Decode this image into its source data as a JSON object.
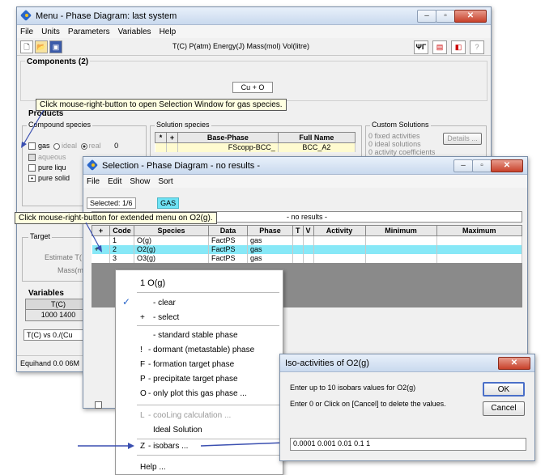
{
  "main_window": {
    "title": "Menu - Phase Diagram: last system",
    "menu": [
      "File",
      "Units",
      "Parameters",
      "Variables",
      "Help"
    ],
    "units_text": "T(C) P(atm) Energy(J) Mass(mol) Vol(litre)",
    "components_label": "Components",
    "components_count": "(2)",
    "components_value": "Cu + O",
    "products_label": "Products",
    "compound_species_label": "Compound species",
    "gas_label": "gas",
    "ideal_label": "ideal",
    "real_label": "real",
    "gas_count": "0",
    "aqueous_label": "aqueous",
    "pure_liquid_label": "pure liqu",
    "pure_solid_label": "pure solid",
    "solution_species_label": "Solution species",
    "solution_headers": [
      "*",
      "+",
      "Base-Phase",
      "Full Name"
    ],
    "solution_row": [
      "FScopp-BCC_",
      "BCC_A2"
    ],
    "custom_solutions_label": "Custom Solutions",
    "fixed_activities": "fixed activities",
    "ideal_solutions": "ideal solutions",
    "activity_coefficients": "activity coefficients",
    "details_button": "Details ...",
    "zero": "0",
    "target_label": "Target",
    "estimate_label": "Estimate T(",
    "mass_label": "Mass(m",
    "variables_label": "Variables",
    "var_header": "T(C)",
    "var_value": "1000 1400",
    "axis_label": "T(C) vs 0./(Cu",
    "status": "Equihand 0.0 06M"
  },
  "tooltip_main": "Click mouse-right-button to open Selection Window for gas species.",
  "selection_window": {
    "title": "Selection - Phase Diagram   - no results -",
    "menu": [
      "File",
      "Edit",
      "Show",
      "Sort"
    ],
    "selected_label": "Selected: 1/6",
    "gas_tag": "GAS",
    "no_results": "- no results -",
    "headers": [
      "+",
      "Code",
      "Species",
      "Data",
      "Phase",
      "T",
      "V",
      "Activity",
      "Minimum",
      "Maximum"
    ],
    "rows": [
      {
        "plus": "",
        "code": "1",
        "species": "O(g)",
        "data": "FactPS",
        "phase": "gas"
      },
      {
        "plus": "+",
        "code": "2",
        "species": "O2(g)",
        "data": "FactPS",
        "phase": "gas"
      },
      {
        "plus": "",
        "code": "3",
        "species": "O3(g)",
        "data": "FactPS",
        "phase": "gas"
      }
    ]
  },
  "tooltip_selection": "Click mouse-right-button for extended menu on O2(g).",
  "context_menu": {
    "header": "1  O(g)",
    "check_mark": "✓",
    "clear": "- clear",
    "select_prefix": "+",
    "select": "- select",
    "standard": "- standard stable phase",
    "dormant_prefix": "!",
    "dormant": "- dormant (metastable) phase",
    "formation_prefix": "F",
    "formation": "- formation target phase",
    "precipitate_prefix": "P",
    "precipitate": "- precipitate target phase",
    "only_plot_prefix": "O",
    "only_plot": "- only plot this gas phase ...",
    "cooling_prefix": "L",
    "cooling": "- cooLing calculation ...",
    "ideal_solution": "Ideal Solution",
    "isobars_prefix": "Z",
    "isobars": "- isobars ...",
    "help": "Help ..."
  },
  "iso_dialog": {
    "title": "Iso-activities of O2(g)",
    "line1": "Enter up to 10 isobars values for O2(g)",
    "line2": "Enter 0 or Click on [Cancel] to delete the values.",
    "ok": "OK",
    "cancel": "Cancel",
    "input_value": "0.0001 0.001 0.01 0.1 1"
  },
  "colors": {
    "selected_row": "#87e8f7",
    "tooltip_bg": "#ffffe1",
    "gas_tag_bg": "#6fe3f5",
    "arrow": "#3a4fb0"
  }
}
